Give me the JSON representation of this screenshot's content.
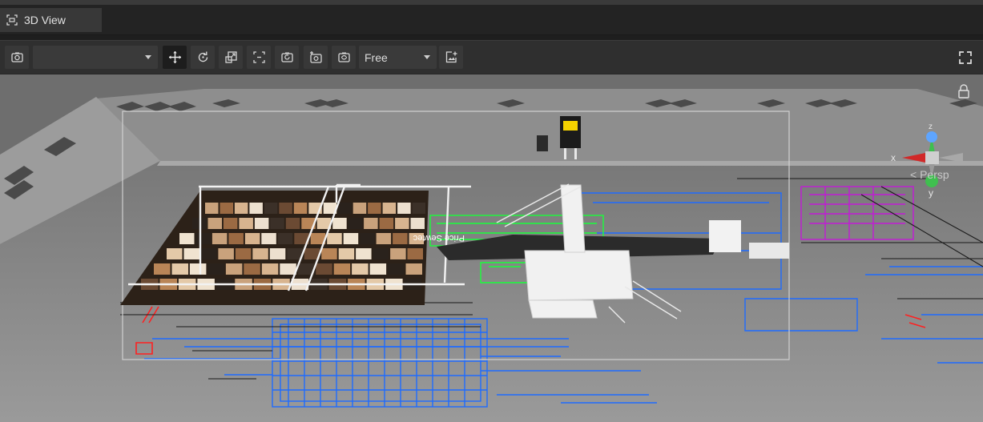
{
  "tab": {
    "label": "3D View",
    "icon": "view-3d-icon"
  },
  "toolbar": {
    "camera_select_value": "",
    "mode_select_value": "Free",
    "buttons": [
      "camera-icon",
      "move-icon",
      "rotate-icon",
      "scale-icon",
      "frame-icon",
      "snapshot-icon",
      "add-camera-icon",
      "capture-icon",
      "export-icon",
      "fullscreen-icon"
    ]
  },
  "viewport": {
    "projection_label": "< Persp",
    "axis_x_label": "x",
    "axis_y_label": "y",
    "axis_z_label": "z",
    "banner_text": "Price Sewtec",
    "colors": {
      "floor": "#8a8a8a",
      "wall": "#9b9b9b",
      "blueprint_blue": "#1e6bff",
      "blueprint_green": "#19ff3a",
      "blueprint_magenta": "#c21ad6",
      "blueprint_red": "#ff2020",
      "axis_x": "#d12828",
      "axis_y": "#3fbf4f",
      "axis_z": "#5ea5ff"
    }
  }
}
